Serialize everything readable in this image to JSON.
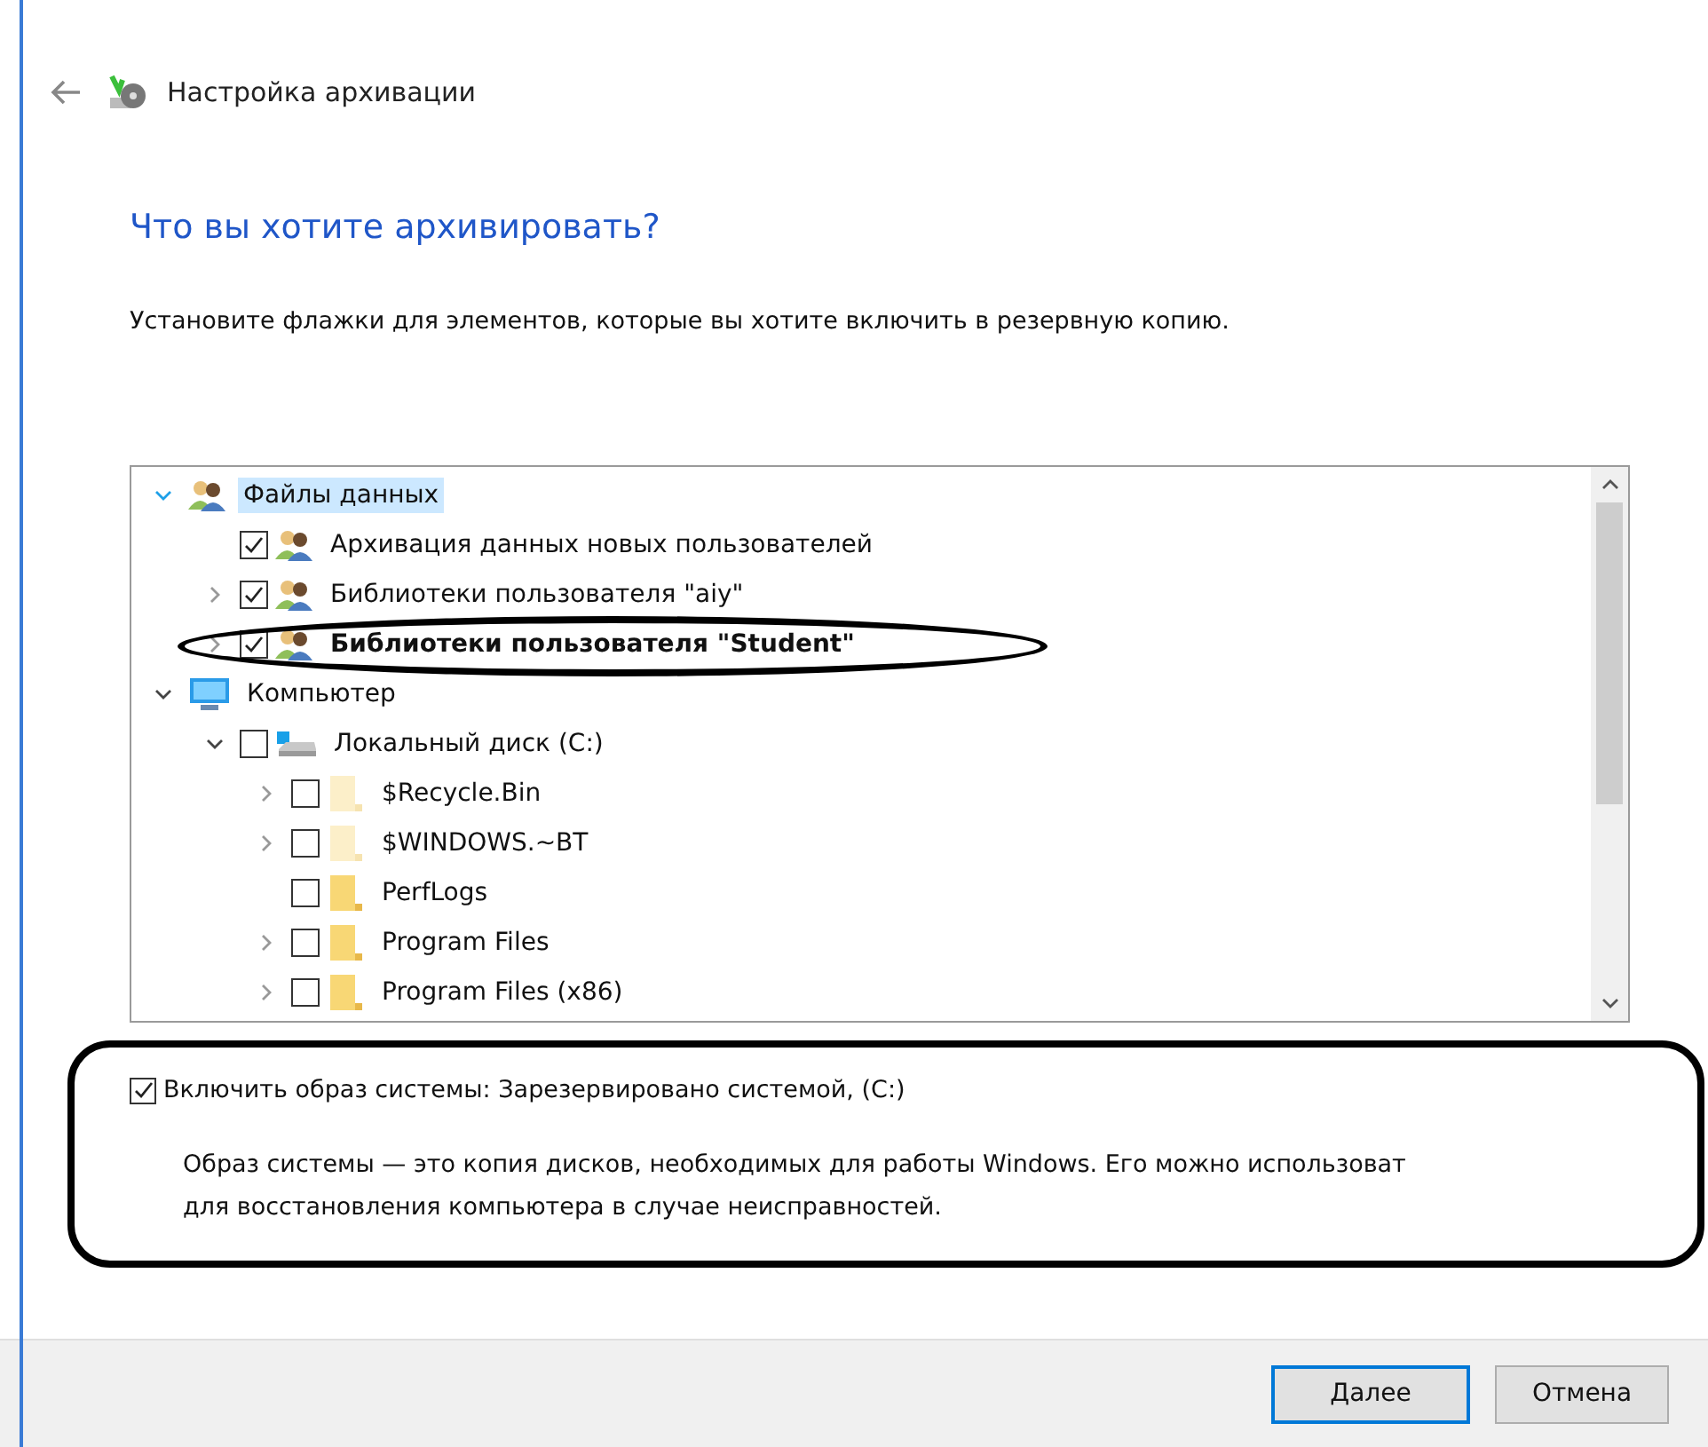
{
  "header": {
    "title": "Настройка архивации"
  },
  "heading": "Что вы хотите архивировать?",
  "instruction": "Установите флажки для элементов, которые вы хотите включить в резервную копию.",
  "tree": [
    {
      "label": "Файлы данных",
      "kind": "users",
      "expanded": true,
      "selected": true,
      "children": [
        {
          "label": "Архивация данных новых пользователей",
          "kind": "users",
          "checked": true,
          "selected": false
        },
        {
          "label": "Библиотеки пользователя \"aiy\"",
          "kind": "users",
          "checked": true,
          "expanded": false,
          "selected": false
        },
        {
          "label": "Библиотеки пользователя \"Student\"",
          "kind": "users",
          "checked": true,
          "expanded": false,
          "selected": false,
          "bold": true
        }
      ]
    },
    {
      "label": "Компьютер",
      "kind": "computer",
      "expanded": true,
      "selected": false,
      "children": [
        {
          "label": "Локальный диск (C:)",
          "kind": "drive",
          "checked": false,
          "expanded": true,
          "selected": false,
          "children": [
            {
              "label": "$Recycle.Bin",
              "kind": "folder",
              "hidden": true,
              "checked": false,
              "expanded": false,
              "selected": false
            },
            {
              "label": "$WINDOWS.~BT",
              "kind": "folder",
              "hidden": true,
              "checked": false,
              "expanded": false,
              "selected": false
            },
            {
              "label": "PerfLogs",
              "kind": "folder",
              "hidden": false,
              "checked": false,
              "selected": false
            },
            {
              "label": "Program Files",
              "kind": "folder",
              "hidden": false,
              "checked": false,
              "expanded": false,
              "selected": false
            },
            {
              "label": "Program Files (x86)",
              "kind": "folder",
              "hidden": false,
              "checked": false,
              "expanded": false,
              "selected": false
            }
          ]
        }
      ]
    }
  ],
  "system_image": {
    "label": "Включить образ системы: Зарезервировано системой, (C:)",
    "checked": true,
    "description_lines": [
      "Образ системы — это копия дисков, необходимых для работы Windows. Его можно использоват",
      "для восстановления компьютера в случае неисправностей."
    ]
  },
  "buttons": [
    {
      "label": "Далее",
      "default": true
    },
    {
      "label": "Отмена",
      "default": false
    }
  ]
}
